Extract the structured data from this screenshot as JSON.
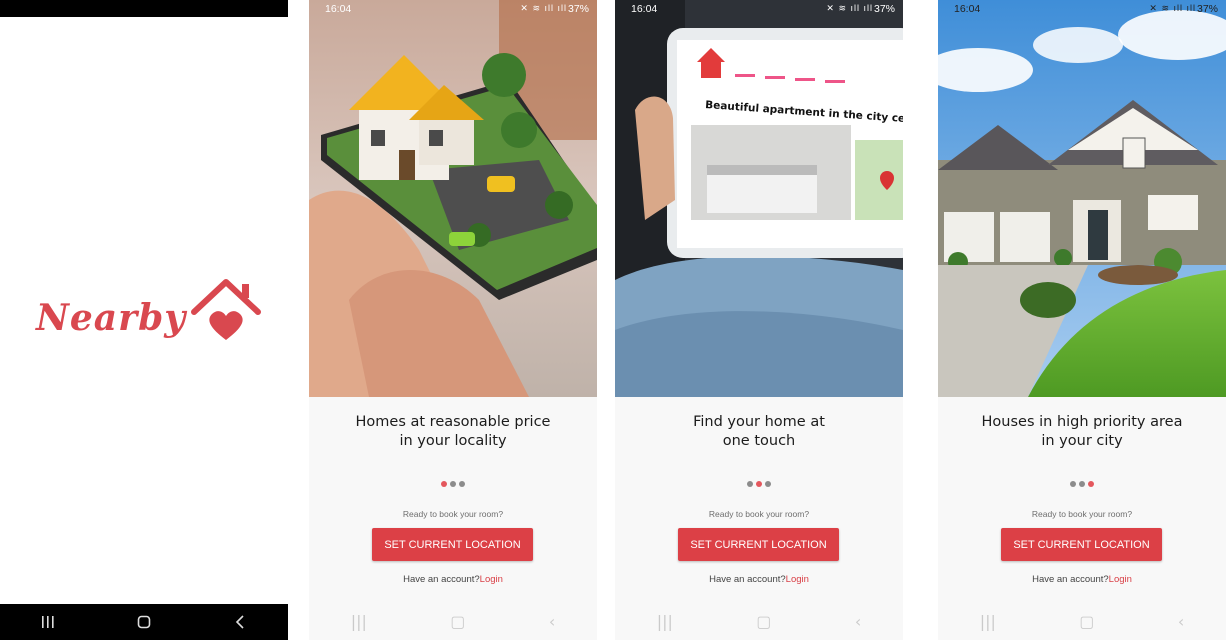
{
  "splash": {
    "logo_text": "Nearby",
    "brand_color": "#d9484f",
    "nav_icons": [
      "recent-apps-icon",
      "home-icon",
      "back-icon"
    ]
  },
  "status_bar": {
    "time": "16:04",
    "battery": "37%"
  },
  "onboarding": [
    {
      "title_line1": "Homes at reasonable price",
      "title_line2": "in your locality",
      "active_dot": 0
    },
    {
      "title_line1": "Find your home at",
      "title_line2": "one touch",
      "active_dot": 1,
      "tablet_text": "Beautiful apartment in the city centre"
    },
    {
      "title_line1": "Houses in high priority area",
      "title_line2": "in your city",
      "active_dot": 2
    }
  ],
  "cta": {
    "prompt": "Ready to book your room?",
    "button_label": "SET CURRENT LOCATION",
    "account_text": "Have an account?",
    "login_label": "Login",
    "button_color": "#dc4046"
  }
}
